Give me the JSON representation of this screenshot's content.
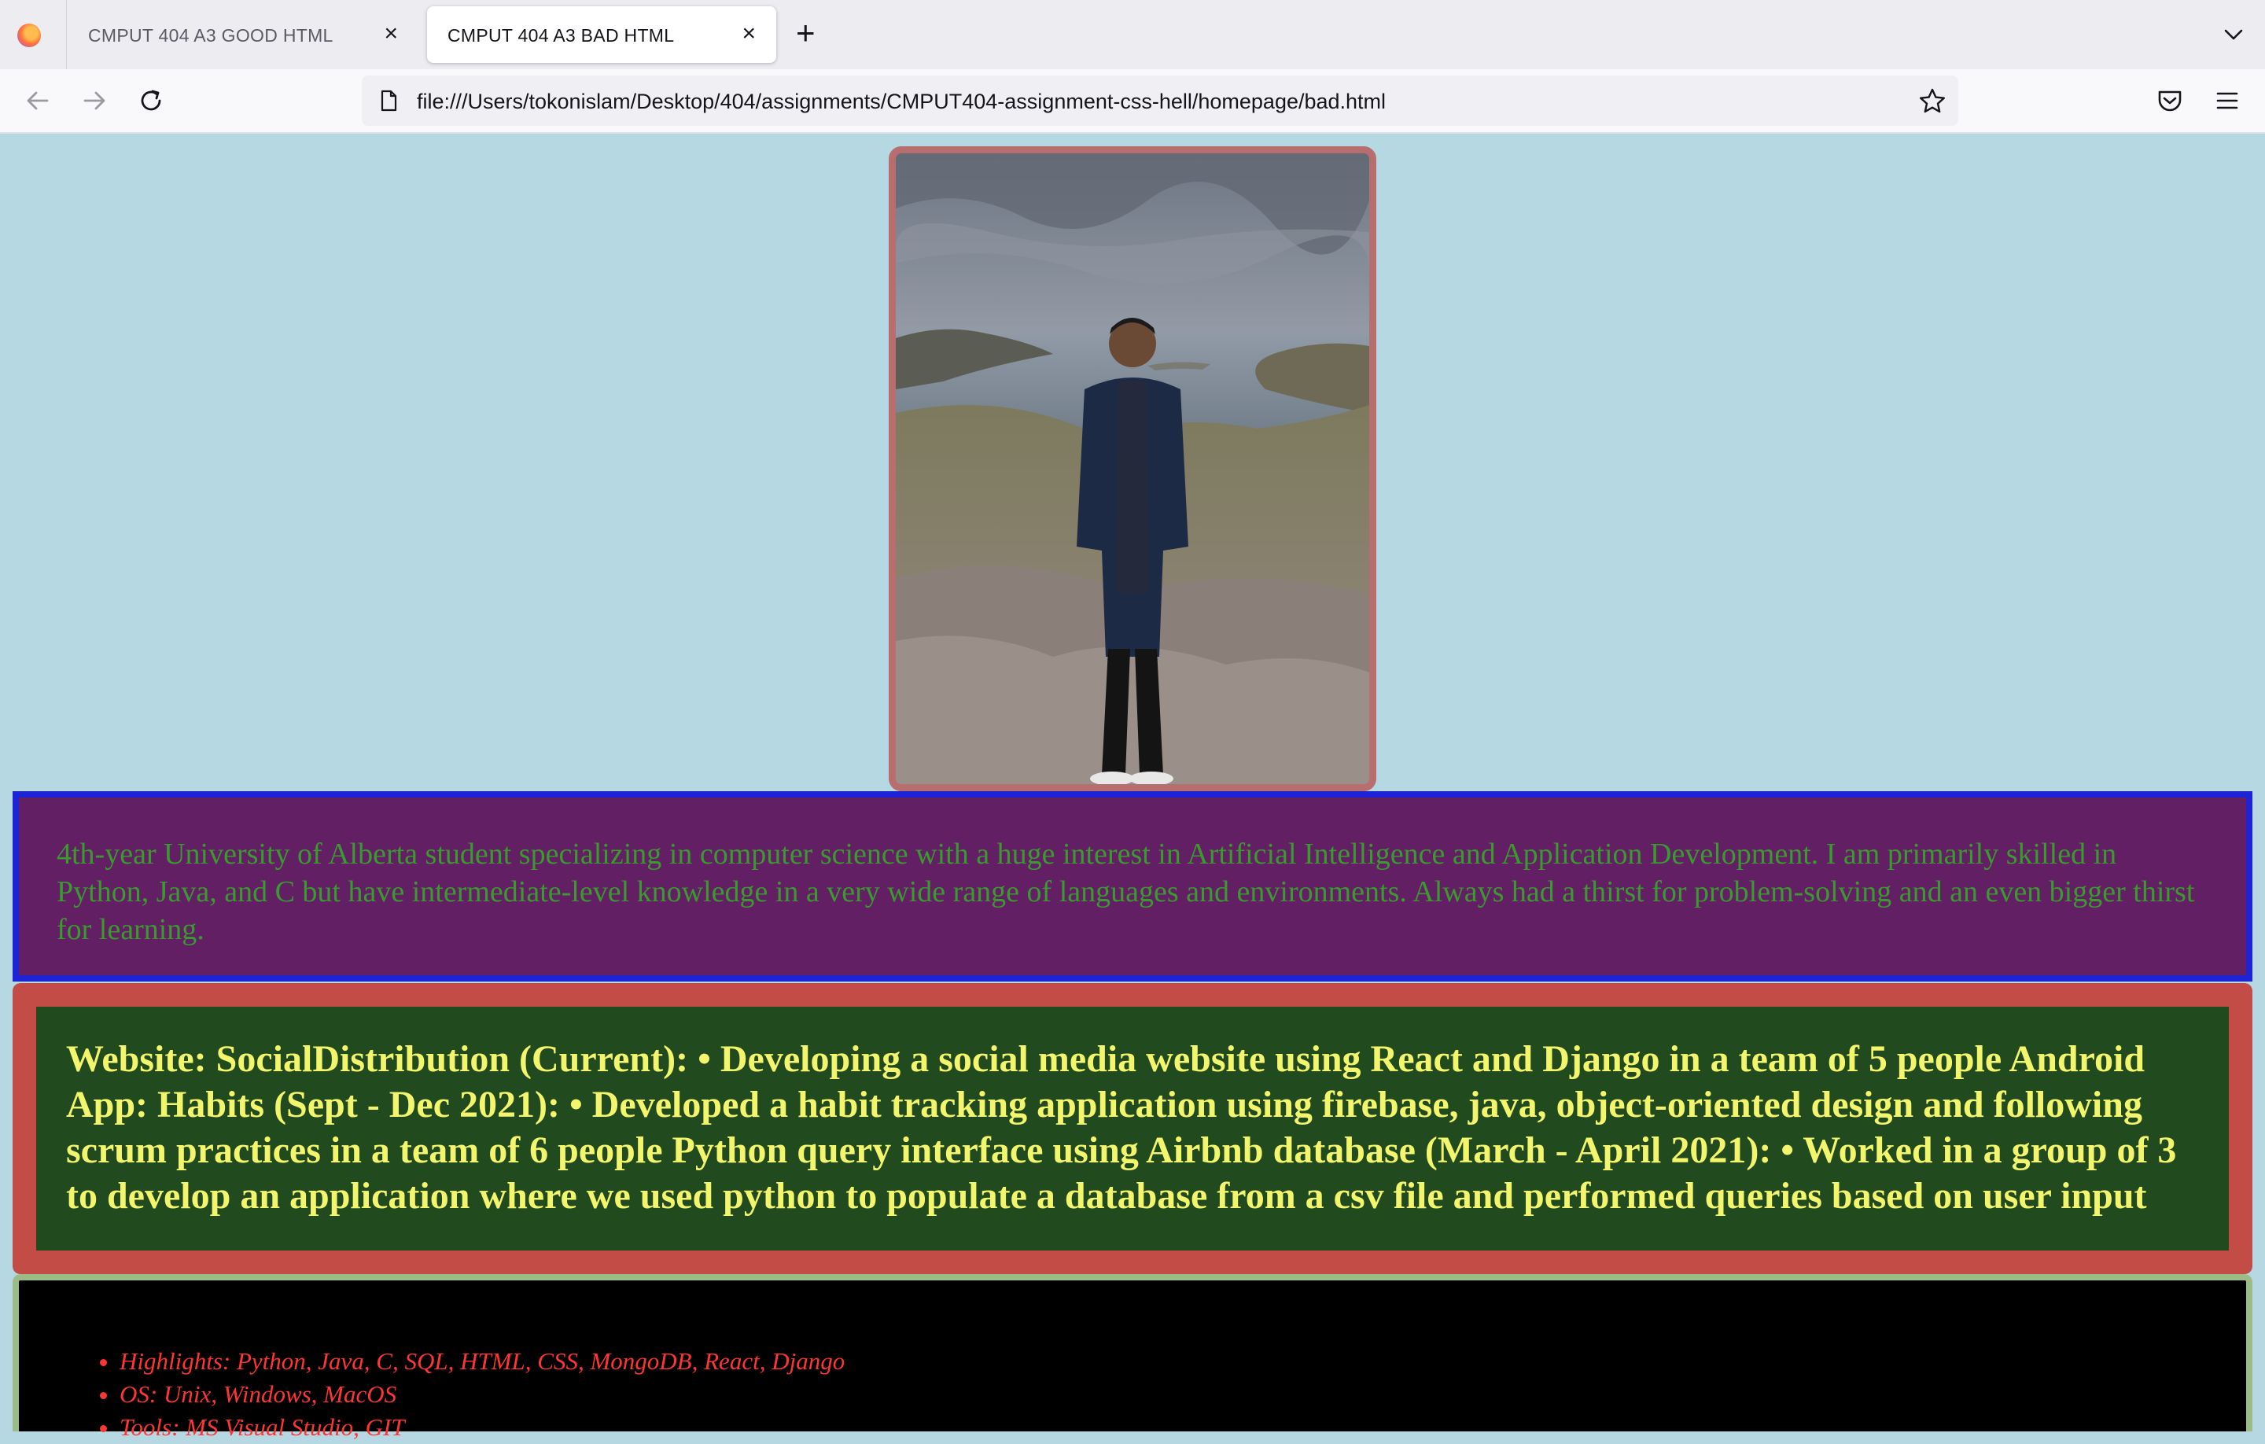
{
  "browser": {
    "tabs": [
      {
        "title": "CMPUT 404 A3 GOOD HTML",
        "active": false
      },
      {
        "title": "CMPUT 404 A3 BAD HTML",
        "active": true
      }
    ],
    "close_glyph": "×",
    "new_tab_glyph": "+",
    "url": "file:///Users/tokonislam/Desktop/404/assignments/CMPUT404-assignment-css-hell/homepage/bad.html",
    "icons": [
      "firefox-logo",
      "back-arrow-icon",
      "forward-arrow-icon",
      "reload-icon",
      "page-icon",
      "bookmark-star-icon",
      "pocket-icon",
      "menu-icon",
      "tab-list-chevron-icon"
    ]
  },
  "page": {
    "background": "#b5d8e3",
    "photo": {
      "description_icon": "profile-photo",
      "border_color": "#b86e6f"
    },
    "about": {
      "text": "4th-year University of Alberta student specializing in computer science with a huge interest in Artificial Intelligence and Application Development. I am primarily skilled in Python, Java, and C but have intermediate-level knowledge in a very wide range of languages and environments. Always had a thirst for problem-solving and an even bigger thirst for learning.",
      "colors": {
        "background": "#631f64",
        "border": "#1d24d6",
        "text": "#3a9a2f"
      }
    },
    "experience": {
      "text": "Website: SocialDistribution (Current): • Developing a social media website using React and Django in a team of 5 people Android App: Habits (Sept - Dec 2021): • Developed a habit tracking application using firebase, java, object-oriented design and following scrum practices in a team of 6 people Python query interface using Airbnb database (March - April 2021): • Worked in a group of 3 to develop an application where we used python to populate a database from a csv file and performed queries based on user input",
      "colors": {
        "outer": "#c44c47",
        "inner": "#224a1f",
        "text": "#f3f56c"
      }
    },
    "skills": {
      "items": [
        "Highlights: Python, Java, C, SQL, HTML, CSS, MongoDB, React, Django",
        "OS: Unix, Windows, MacOS",
        "Tools: MS Visual Studio, GIT"
      ],
      "colors": {
        "background": "#000000",
        "border": "#9cbc87",
        "text": "#ff3535"
      }
    }
  }
}
